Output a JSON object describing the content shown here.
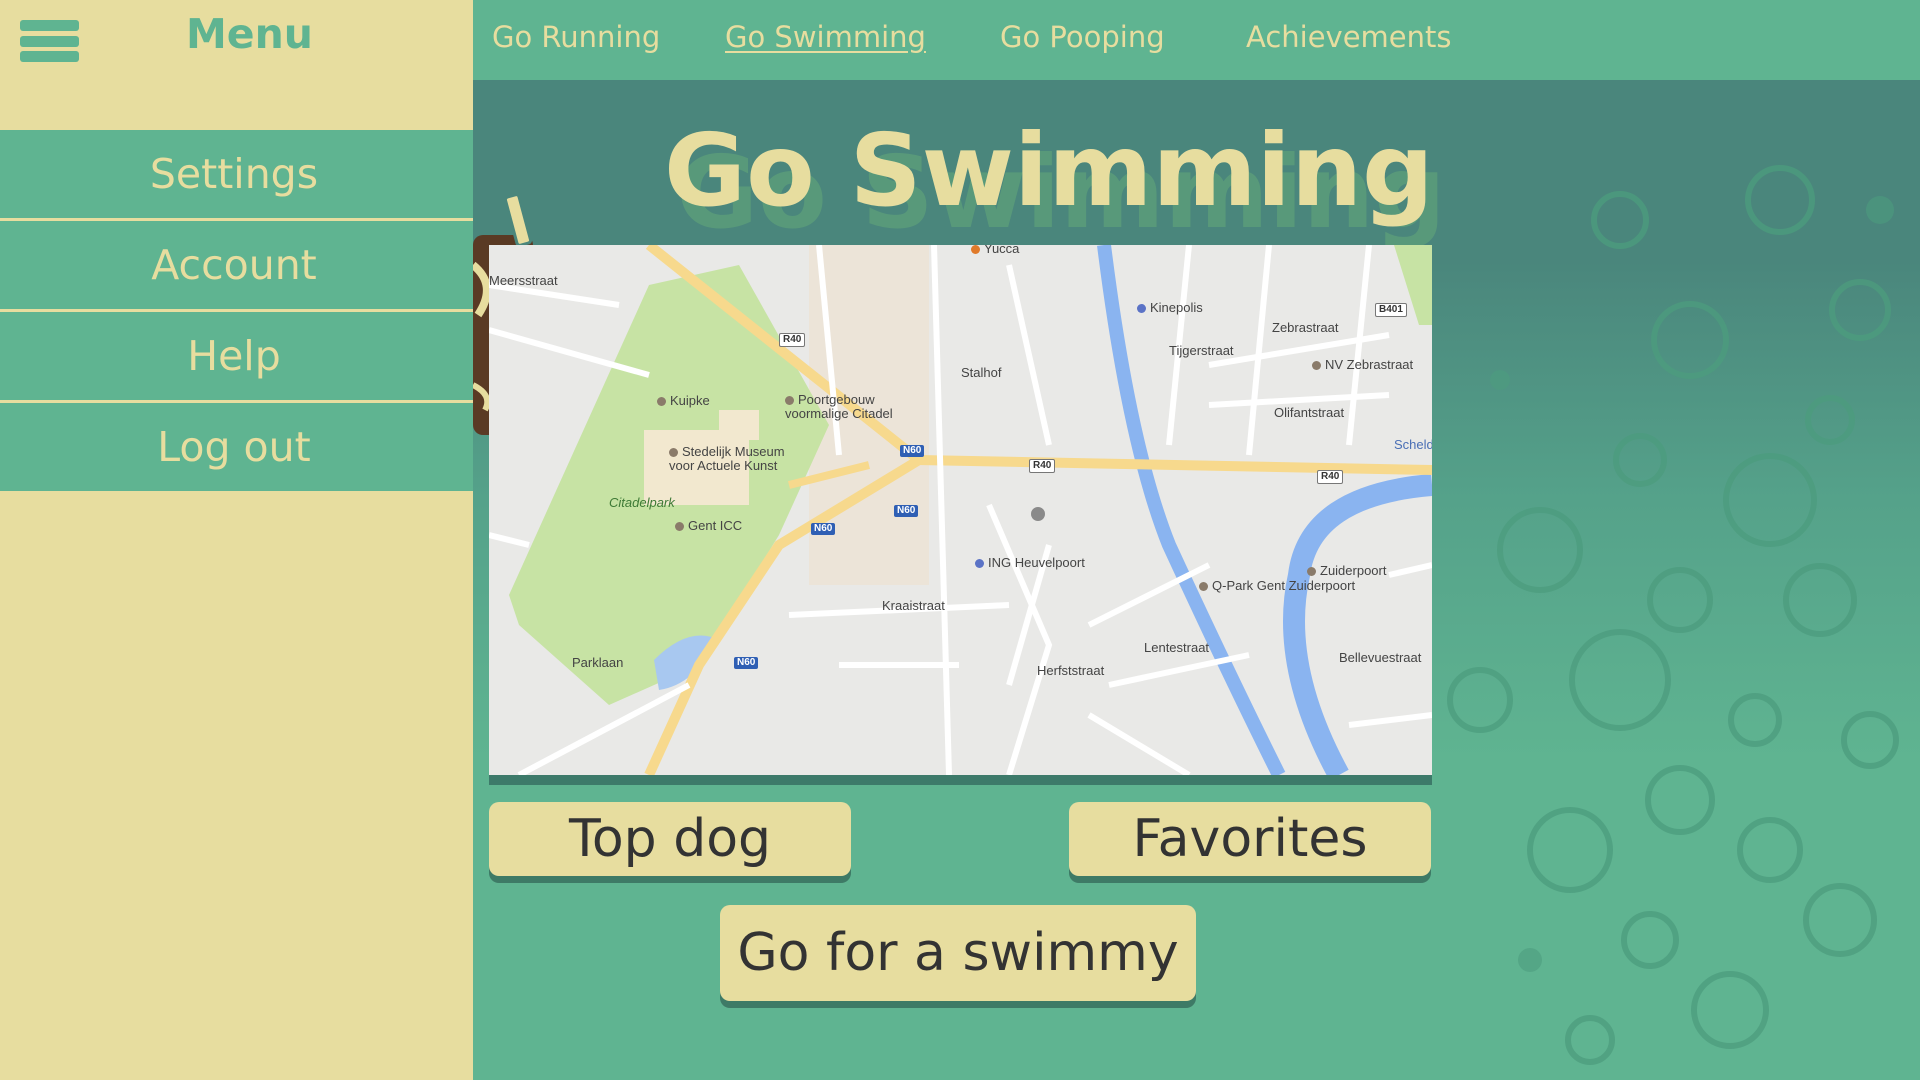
{
  "sidebar": {
    "title": "Menu",
    "items": [
      {
        "label": "Settings"
      },
      {
        "label": "Account"
      },
      {
        "label": "Help"
      },
      {
        "label": "Log out"
      }
    ]
  },
  "nav": {
    "links": [
      {
        "label": "Go Running"
      },
      {
        "label": "Go Swimming",
        "active": true
      },
      {
        "label": "Go Pooping"
      },
      {
        "label": "Achievements"
      }
    ]
  },
  "main": {
    "title": "Go Swimming",
    "buttons": {
      "top_dog": "Top dog",
      "favorites": "Favorites",
      "go_swim": "Go for a swimmy"
    }
  },
  "map": {
    "labels": {
      "yucca": "Yucca",
      "kinepolis": "Kinepolis",
      "nv_zebrastraat": "NV Zebrastraat",
      "kuipke": "Kuipke",
      "poortgebouw": "Poortgebouw voormalige Citadel",
      "smak": "Stedelijk Museum voor Actuele Kunst",
      "citadelpark": "Citadelpark",
      "gent_icc": "Gent ICC",
      "ing": "ING Heuvelpoort",
      "zuiderpoort": "Zuiderpoort",
      "qpark": "Q-Park Gent Zuiderpoort",
      "meersstraat": "Meersstraat",
      "stalhof": "Stalhof",
      "tijgerstraat": "Tijgerstraat",
      "zebrastraat": "Zebrastraat",
      "olifantstraat": "Olifantstraat",
      "kraaistraat": "Kraaistraat",
      "herfststraat": "Herfststraat",
      "parklaan": "Parklaan",
      "lentestraat": "Lentestraat",
      "bellevuestraat": "Bellevuestraat",
      "schelde": "Schelde"
    },
    "roads": {
      "r40": "R40",
      "n60": "N60",
      "b401": "B401"
    }
  },
  "colors": {
    "accent": "#5fb491",
    "cream": "#e7dd9f",
    "dark_teal": "#4a867c"
  },
  "icons": [
    "hamburger-menu-icon"
  ]
}
